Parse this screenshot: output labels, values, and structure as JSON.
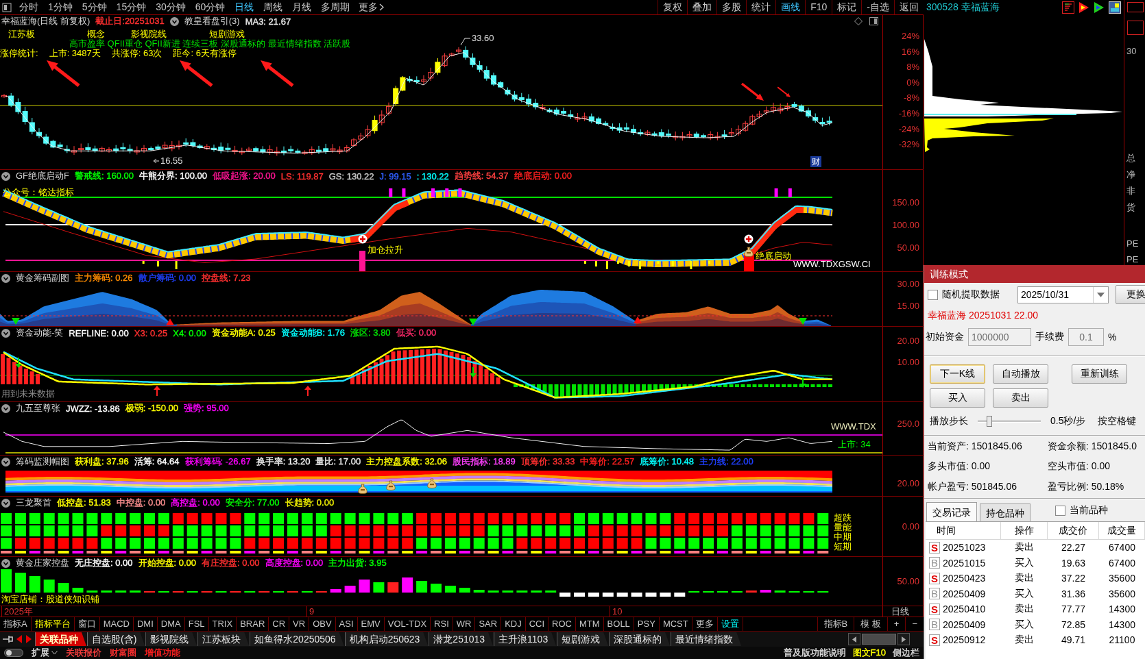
{
  "toolbar": {
    "periods": [
      {
        "label": "分时",
        "selected": false
      },
      {
        "label": "1分钟",
        "selected": false
      },
      {
        "label": "5分钟",
        "selected": false
      },
      {
        "label": "15分钟",
        "selected": false
      },
      {
        "label": "30分钟",
        "selected": false
      },
      {
        "label": "60分钟",
        "selected": false
      },
      {
        "label": "日线",
        "selected": true
      },
      {
        "label": "周线",
        "selected": false
      },
      {
        "label": "月线",
        "selected": false
      },
      {
        "label": "多周期",
        "selected": false
      }
    ],
    "more": "更多",
    "tools": [
      {
        "label": "复权",
        "on": false
      },
      {
        "label": "叠加",
        "on": false
      },
      {
        "label": "多股",
        "on": false
      },
      {
        "label": "统计",
        "on": false
      },
      {
        "label": "画线",
        "on": true
      },
      {
        "label": "F10",
        "on": false
      },
      {
        "label": "标记",
        "on": false
      },
      {
        "label": "-自选",
        "on": false
      },
      {
        "label": "返回",
        "on": false
      }
    ]
  },
  "price_pane": {
    "title": "幸福蓝海(日线 前复权)",
    "end_date": "截止日:20251031",
    "indicator": "教皇看盘引(3)",
    "ma": "MA3: 21.67",
    "concepts": [
      "江苏板",
      "概念",
      "影视院线",
      "短剧游戏"
    ],
    "tags": "高市盈率 QFII重仓 QFII新进 连续三板 深股通标的 最近情绪指数 活跃股",
    "limit_stats": [
      "涨停统计:",
      "上市: 3487天",
      "共涨停: 63次",
      "距今: 6天有涨停"
    ],
    "high_label": "33.60",
    "low_label": "16.55",
    "badge": "财",
    "axis": [
      "24%",
      "16%",
      "8%",
      "0%",
      "-8%",
      "-16%",
      "-24%",
      "-32%"
    ]
  },
  "panes": [
    {
      "kind": "gf",
      "name": "GF绝底启动F",
      "values": [
        {
          "text": "警戒线: 160.00",
          "color": "#00ff00"
        },
        {
          "text": "牛熊分界: 100.00",
          "color": "#ffffff"
        },
        {
          "text": "低吸起涨: 20.00",
          "color": "#ff1493"
        },
        {
          "text": "LS: 119.87",
          "color": "#ff3030"
        },
        {
          "text": "GS: 130.22",
          "color": "#c8c8c8"
        },
        {
          "text": "J: 99.15",
          "color": "#3060ff"
        },
        {
          "text": ": 130.22",
          "color": "#00ffff"
        },
        {
          "text": "趋势线: 54.37",
          "color": "#ff4040"
        },
        {
          "text": "绝底启动: 0.00",
          "color": "#ff2020"
        }
      ],
      "axis": [
        "150.00",
        "100.00",
        "50.00"
      ],
      "labels": [
        "公众号：铭达指标",
        "加仓拉升",
        "绝底启动",
        "WWW.TDXGSW.CI"
      ]
    },
    {
      "kind": "chips",
      "name": "黄金筹码副图",
      "values": [
        {
          "text": "主力筹码: 0.26",
          "color": "#ff8c00"
        },
        {
          "text": "散户筹码: 0.00",
          "color": "#2040ff"
        },
        {
          "text": "控盘线: 7.23",
          "color": "#ff3030"
        }
      ],
      "axis": [
        "30.00",
        "15.00"
      ]
    },
    {
      "kind": "fund",
      "name": "资金动能-笑",
      "values": [
        {
          "text": "REFLINE: 0.00",
          "color": "#ffffff"
        },
        {
          "text": "X3: 0.25",
          "color": "#ff3030"
        },
        {
          "text": "X4: 0.00",
          "color": "#00ff00"
        },
        {
          "text": "资金动能A: 0.25",
          "color": "#ffff00"
        },
        {
          "text": "资金动能B: 1.76",
          "color": "#00ffff"
        },
        {
          "text": "涨区: 3.80",
          "color": "#00e000"
        },
        {
          "text": "低买: 0.00",
          "color": "#ff2a6a"
        }
      ],
      "axis": [
        "20.00",
        "10.00"
      ],
      "labels": [
        "用到未来数据"
      ]
    },
    {
      "kind": "jwzz",
      "name": "九五至尊张",
      "values": [
        {
          "text": "JWZZ: -13.86",
          "color": "#ffffff"
        },
        {
          "text": "极弱: -150.00",
          "color": "#ffff00"
        },
        {
          "text": "强势: 95.00",
          "color": "#ff00ff"
        }
      ],
      "axis": [
        "250.0"
      ],
      "labels": [
        "WWW.TDX",
        "上市: 34"
      ]
    },
    {
      "kind": "cap",
      "name": "筹码监测帽图",
      "values": [
        {
          "text": "获利盘: 37.96",
          "color": "#ffff00"
        },
        {
          "text": "活筹: 64.64",
          "color": "#ffffff"
        },
        {
          "text": "获利筹码: -26.67",
          "color": "#ff00ff"
        },
        {
          "text": "换手率: 13.20",
          "color": "#f0f0f0"
        },
        {
          "text": "量比: 17.00",
          "color": "#e8e8e8"
        },
        {
          "text": "主力控盘系数: 32.06",
          "color": "#ffff00"
        },
        {
          "text": "股民指标: 18.89",
          "color": "#ff40ff"
        },
        {
          "text": "顶筹价: 33.33",
          "color": "#ff3030"
        },
        {
          "text": "中筹价: 22.57",
          "color": "#ff2020"
        },
        {
          "text": "底筹价: 10.48",
          "color": "#00ffff"
        },
        {
          "text": "主力线: 22.00",
          "color": "#2040ff"
        }
      ],
      "axis": [
        "20.00"
      ]
    },
    {
      "kind": "dragon",
      "name": "三龙聚首",
      "values": [
        {
          "text": "低控盘: 51.83",
          "color": "#ffff00"
        },
        {
          "text": "中控盘: 0.00",
          "color": "#ff9090"
        },
        {
          "text": "高控盘: 0.00",
          "color": "#ff00ff"
        },
        {
          "text": "安全分: 77.00",
          "color": "#00ff00"
        },
        {
          "text": "长趋势: 0.00",
          "color": "#f0f000"
        }
      ],
      "axis": [
        "0.00"
      ],
      "labels": [
        "超跌",
        "量能",
        "中期",
        "短期"
      ]
    },
    {
      "kind": "banker",
      "name": "黄金庄家控盘",
      "values": [
        {
          "text": "无庄控盘: 0.00",
          "color": "#ffffff"
        },
        {
          "text": "开始控盘: 0.00",
          "color": "#ffff00"
        },
        {
          "text": "有庄控盘: 0.00",
          "color": "#ff3030"
        },
        {
          "text": "高度控盘: 0.00",
          "color": "#ff00ff"
        },
        {
          "text": "主力出货: 3.95",
          "color": "#00ff00"
        }
      ],
      "axis": [
        "50.00"
      ],
      "labels": [
        "淘宝店铺：股道侠知识铺"
      ]
    }
  ],
  "date_axis": {
    "labels": [
      "2025年",
      "9",
      "10"
    ],
    "period": "日线"
  },
  "indicator_tabs": [
    {
      "label": "指标A",
      "kind": "plain"
    },
    {
      "label": "指标平台",
      "kind": "platform"
    },
    {
      "label": "窗口",
      "kind": "plain"
    },
    {
      "label": "MACD",
      "kind": "plain"
    },
    {
      "label": "DMI",
      "kind": "plain"
    },
    {
      "label": "DMA",
      "kind": "plain"
    },
    {
      "label": "FSL",
      "kind": "plain"
    },
    {
      "label": "TRIX",
      "kind": "plain"
    },
    {
      "label": "BRAR",
      "kind": "plain"
    },
    {
      "label": "CR",
      "kind": "plain"
    },
    {
      "label": "VR",
      "kind": "plain"
    },
    {
      "label": "OBV",
      "kind": "plain"
    },
    {
      "label": "ASI",
      "kind": "plain"
    },
    {
      "label": "EMV",
      "kind": "plain"
    },
    {
      "label": "VOL-TDX",
      "kind": "plain"
    },
    {
      "label": "RSI",
      "kind": "plain"
    },
    {
      "label": "WR",
      "kind": "plain"
    },
    {
      "label": "SAR",
      "kind": "plain"
    },
    {
      "label": "KDJ",
      "kind": "plain"
    },
    {
      "label": "CCI",
      "kind": "plain"
    },
    {
      "label": "ROC",
      "kind": "plain"
    },
    {
      "label": "MTM",
      "kind": "plain"
    },
    {
      "label": "BOLL",
      "kind": "plain"
    },
    {
      "label": "PSY",
      "kind": "plain"
    },
    {
      "label": "MCST",
      "kind": "plain"
    },
    {
      "label": "更多",
      "kind": "plain"
    },
    {
      "label": "设置",
      "kind": "settings"
    }
  ],
  "template_tabs": [
    "指标B",
    "模 板",
    "+",
    "−"
  ],
  "block_tabs": [
    {
      "label": "关联品种",
      "selected": true
    },
    {
      "label": "自选股(含)",
      "selected": false
    },
    {
      "label": "影视院线",
      "selected": false
    },
    {
      "label": "江苏板块",
      "selected": false
    },
    {
      "label": "如鱼得水20250506",
      "selected": false
    },
    {
      "label": "机构启动250623",
      "selected": false
    },
    {
      "label": "潜龙251013",
      "selected": false
    },
    {
      "label": "主升浪1103",
      "selected": false
    },
    {
      "label": "短剧游戏",
      "selected": false
    },
    {
      "label": "深股通标的",
      "selected": false
    },
    {
      "label": "最近情绪指数",
      "selected": false
    }
  ],
  "status_bar": {
    "left": [
      {
        "text": "扩展",
        "color": "#e0e0e0"
      },
      {
        "text": "关联报价",
        "color": "#ff4040"
      },
      {
        "text": "财富圈",
        "color": "#ff3030"
      },
      {
        "text": "增值功能",
        "color": "#ff2020"
      }
    ],
    "right": [
      {
        "text": "普及版功能说明",
        "color": "#e0e0e0"
      },
      {
        "text": "图文F10",
        "color": "#ffff00"
      },
      {
        "text": "侧边栏",
        "color": "#d8d8d8"
      }
    ]
  },
  "stock_header": "300528 幸福蓝海",
  "side_strip": [
    "30",
    "总",
    "净",
    "非",
    "货",
    "PE",
    "PE"
  ],
  "training": {
    "title": "训练模式",
    "random": {
      "label": "随机提取数据",
      "checked": false
    },
    "date": "2025/10/31",
    "change_button": "更换",
    "info": "幸福蓝海 20251031 22.00",
    "capital": {
      "label": "初始资金",
      "value": "1000000"
    },
    "fee": {
      "label": "手续费",
      "value": "0.1",
      "unit": "%"
    },
    "buttons": [
      {
        "label": "下一K线",
        "focused": true
      },
      {
        "label": "自动播放",
        "focused": false
      },
      {
        "label": "重新训练",
        "focused": false
      }
    ],
    "trade_buttons": [
      "买入",
      "卖出"
    ],
    "step": {
      "label": "播放步长",
      "level": 0.15,
      "reading": "0.5秒/步",
      "hint": "按空格键"
    },
    "stats": [
      "当前资产: 1501845.06",
      "资金余额: 1501845.0",
      "多头市值: 0.00",
      "空头市值: 0.00",
      "帐户盈亏: 501845.06",
      "盈亏比例: 50.18%"
    ],
    "tabs": [
      {
        "label": "交易记录",
        "selected": true
      },
      {
        "label": "持仓品种",
        "selected": false
      }
    ],
    "current_only": {
      "label": "当前品种",
      "checked": false
    },
    "columns": [
      "时间",
      "操作",
      "成交价",
      "成交量"
    ],
    "trades": [
      {
        "kind": "sell",
        "badge": "S",
        "date": "20251023",
        "action": "卖出",
        "price": "22.27",
        "volume": "67400"
      },
      {
        "kind": "buy",
        "badge": "B",
        "date": "20251015",
        "action": "买入",
        "price": "19.63",
        "volume": "67400"
      },
      {
        "kind": "sell",
        "badge": "S",
        "date": "20250423",
        "action": "卖出",
        "price": "37.22",
        "volume": "35600"
      },
      {
        "kind": "buy",
        "badge": "B",
        "date": "20250409",
        "action": "买入",
        "price": "31.36",
        "volume": "35600"
      },
      {
        "kind": "sell",
        "badge": "S",
        "date": "20250410",
        "action": "卖出",
        "price": "77.77",
        "volume": "14300"
      },
      {
        "kind": "buy",
        "badge": "B",
        "date": "20250409",
        "action": "买入",
        "price": "72.85",
        "volume": "14300"
      },
      {
        "kind": "sell",
        "badge": "S",
        "date": "20250912",
        "action": "卖出",
        "price": "49.71",
        "volume": "21100"
      }
    ]
  }
}
